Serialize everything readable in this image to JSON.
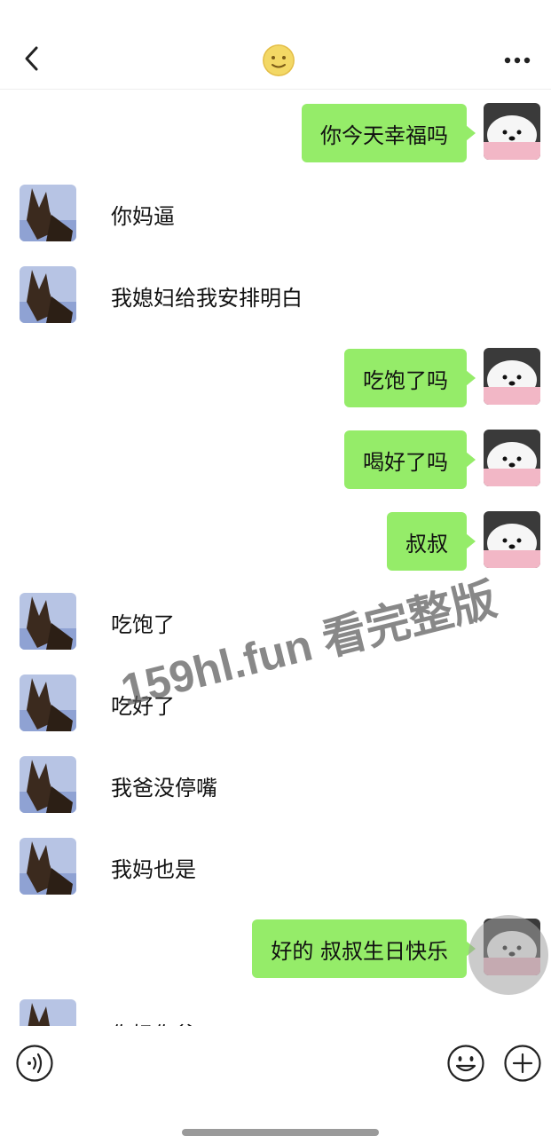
{
  "header": {
    "back_icon": "chevron-left-icon",
    "title_avatar_icon": "emoji-face-icon",
    "more_icon": "more-dots-icon"
  },
  "messages": [
    {
      "side": "right",
      "text": "你今天幸福吗"
    },
    {
      "side": "left",
      "text": "你妈逼"
    },
    {
      "side": "left",
      "text": "我媳妇给我安排明白"
    },
    {
      "side": "right",
      "text": "吃饱了吗"
    },
    {
      "side": "right",
      "text": "喝好了吗"
    },
    {
      "side": "right",
      "text": "叔叔"
    },
    {
      "side": "left",
      "text": "吃饱了"
    },
    {
      "side": "left",
      "text": "吃好了"
    },
    {
      "side": "left",
      "text": "我爸没停嘴"
    },
    {
      "side": "left",
      "text": "我妈也是"
    },
    {
      "side": "right",
      "text": "好的 叔叔生日快乐"
    },
    {
      "side": "left",
      "text": "你妈你爸"
    }
  ],
  "watermark": "159hl.fun 看完整版",
  "input_bar": {
    "voice_icon": "voice-input-icon",
    "emoji_icon": "emoji-icon",
    "plus_icon": "plus-icon"
  },
  "colors": {
    "sent_bubble": "#95ec69",
    "background": "#ffffff"
  }
}
